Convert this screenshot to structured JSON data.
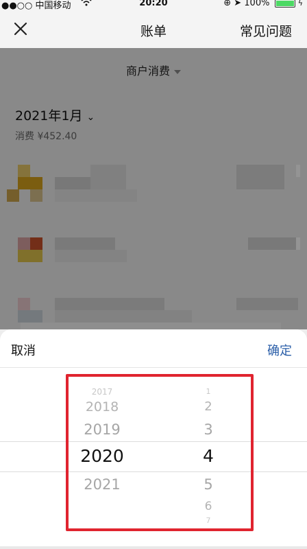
{
  "status_bar": {
    "carrier": "●●○○ 中国移动",
    "wifi_icon": "wifi-icon",
    "time": "20:20",
    "battery": "100%"
  },
  "nav": {
    "close_icon": "close-icon",
    "title": "账单",
    "faq": "常见问题"
  },
  "bill": {
    "filter_label": "商户消费",
    "month_label": "2021年1月",
    "spend_label": "消费 ¥452.40"
  },
  "picker": {
    "cancel": "取消",
    "confirm": "确定",
    "years": [
      "2017",
      "2018",
      "2019",
      "2020",
      "2021"
    ],
    "months": [
      "1",
      "2",
      "3",
      "4",
      "5",
      "6",
      "7"
    ],
    "selected_year": "2020",
    "selected_month": "4",
    "highlight_color": "#e0242f"
  }
}
